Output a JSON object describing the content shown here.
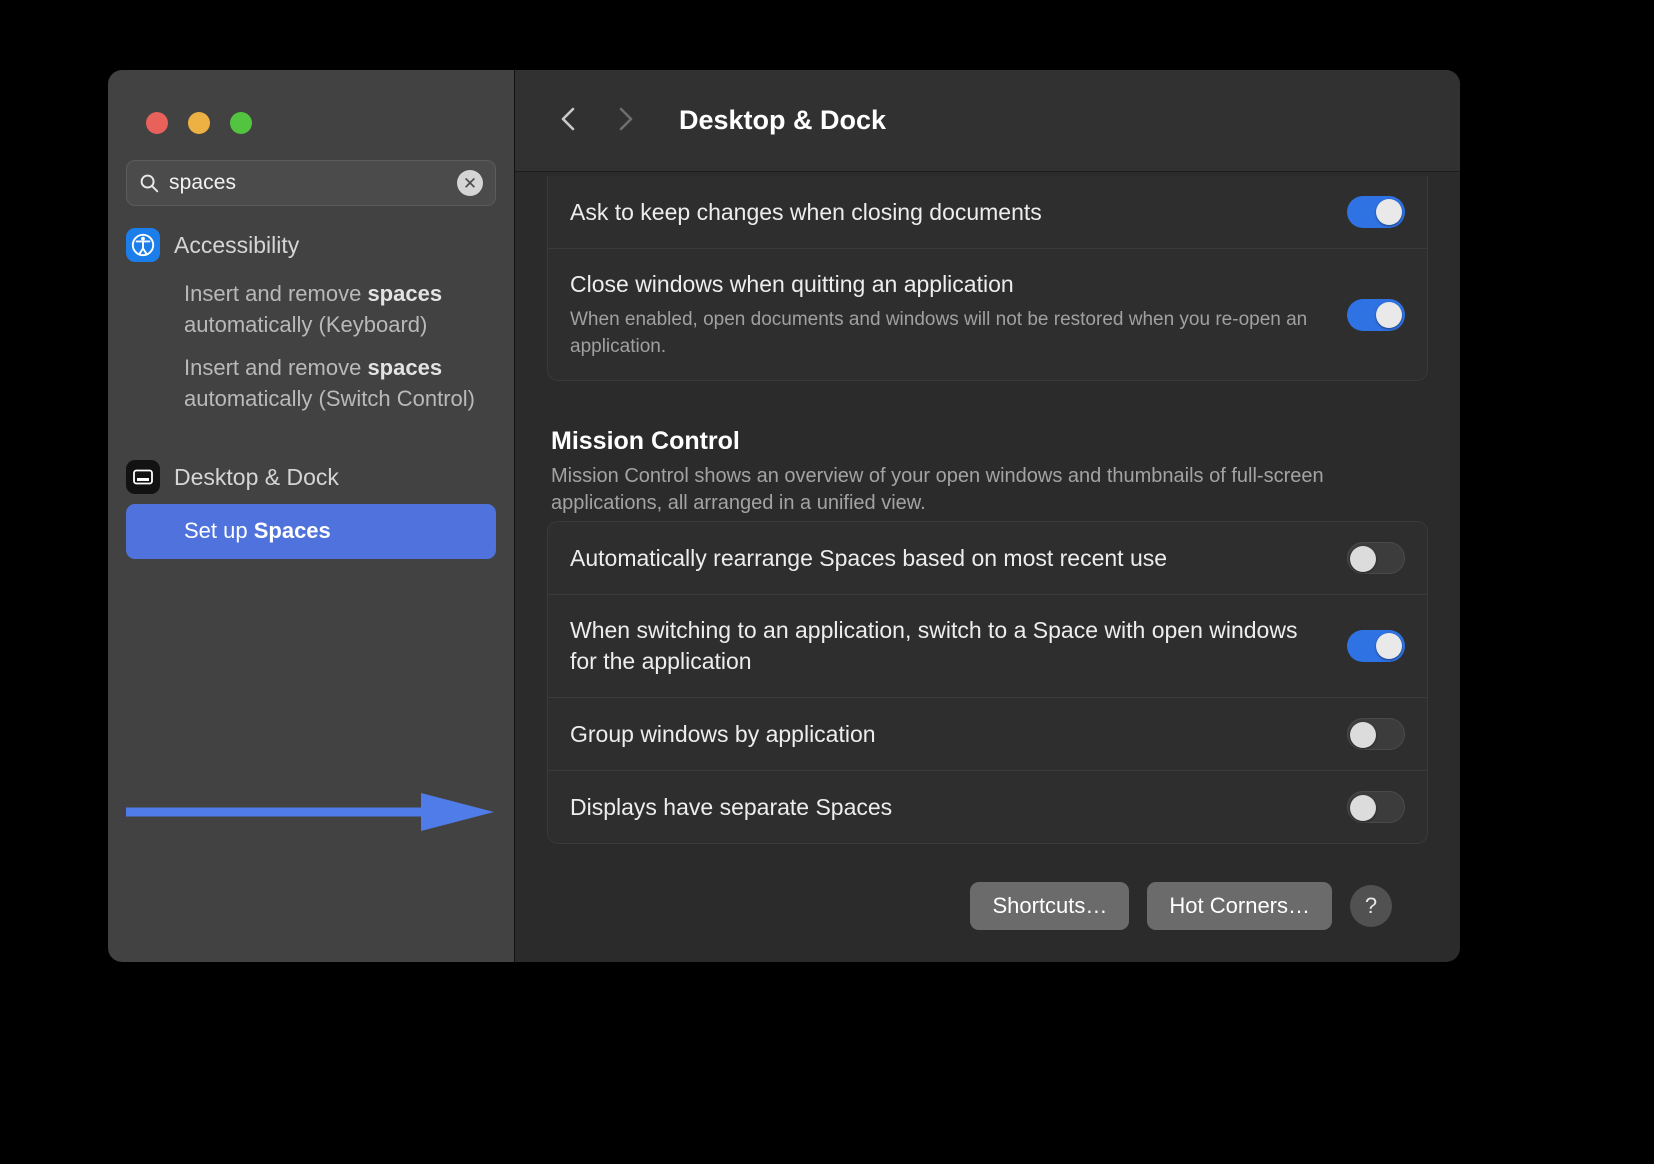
{
  "window": {
    "traffic_lights": [
      {
        "name": "close",
        "color": "#e8615a"
      },
      {
        "name": "minimize",
        "color": "#edb043"
      },
      {
        "name": "zoom",
        "color": "#52c43f"
      }
    ]
  },
  "sidebar": {
    "search": {
      "value": "spaces",
      "placeholder": "Search",
      "icon": "search-icon",
      "clear_icon": "✕"
    },
    "groups": [
      {
        "icon": "accessibility-icon",
        "title": "Accessibility",
        "items": [
          {
            "parts": [
              {
                "text": "Insert and remove ",
                "bold": false
              },
              {
                "text": "spaces",
                "bold": true
              },
              {
                "text": " automatically (Keyboard)",
                "bold": false
              }
            ],
            "selected": false
          },
          {
            "parts": [
              {
                "text": "Insert and remove ",
                "bold": false
              },
              {
                "text": "spaces",
                "bold": true
              },
              {
                "text": " automatically (Switch Control)",
                "bold": false
              }
            ],
            "selected": false
          }
        ]
      },
      {
        "icon": "desktop-dock-icon",
        "title": "Desktop & Dock",
        "items": [
          {
            "parts": [
              {
                "text": "Set up ",
                "bold": false
              },
              {
                "text": "Spaces",
                "bold": true
              }
            ],
            "selected": true
          }
        ]
      }
    ],
    "annotation": {
      "type": "arrow-right",
      "color": "#4f7ce8"
    }
  },
  "detail": {
    "nav": {
      "back_icon": "chevron-left-icon",
      "forward_icon": "chevron-right-icon",
      "back_enabled": true,
      "forward_enabled": false
    },
    "title": "Desktop & Dock",
    "top_card": {
      "rows": [
        {
          "label": "Ask to keep changes when closing documents",
          "sub": "",
          "toggle": "on"
        },
        {
          "label": "Close windows when quitting an application",
          "sub": "When enabled, open documents and windows will not be restored when you re-open an application.",
          "toggle": "on"
        }
      ]
    },
    "mission_control": {
      "title": "Mission Control",
      "description": "Mission Control shows an overview of your open windows and thumbnails of full-screen applications, all arranged in a unified view.",
      "rows": [
        {
          "label": "Automatically rearrange Spaces based on most recent use",
          "sub": "",
          "toggle": "off"
        },
        {
          "label": "When switching to an application, switch to a Space with open windows for the application",
          "sub": "",
          "toggle": "on"
        },
        {
          "label": "Group windows by application",
          "sub": "",
          "toggle": "off"
        },
        {
          "label": "Displays have separate Spaces",
          "sub": "",
          "toggle": "off"
        }
      ]
    },
    "footer": {
      "shortcuts_label": "Shortcuts…",
      "hot_corners_label": "Hot Corners…",
      "help_label": "?"
    }
  },
  "colors": {
    "accent_blue": "#2f72e3",
    "selection_blue": "#4f72dd",
    "window_bg": "#2b2b2b",
    "sidebar_bg": "#424242"
  }
}
